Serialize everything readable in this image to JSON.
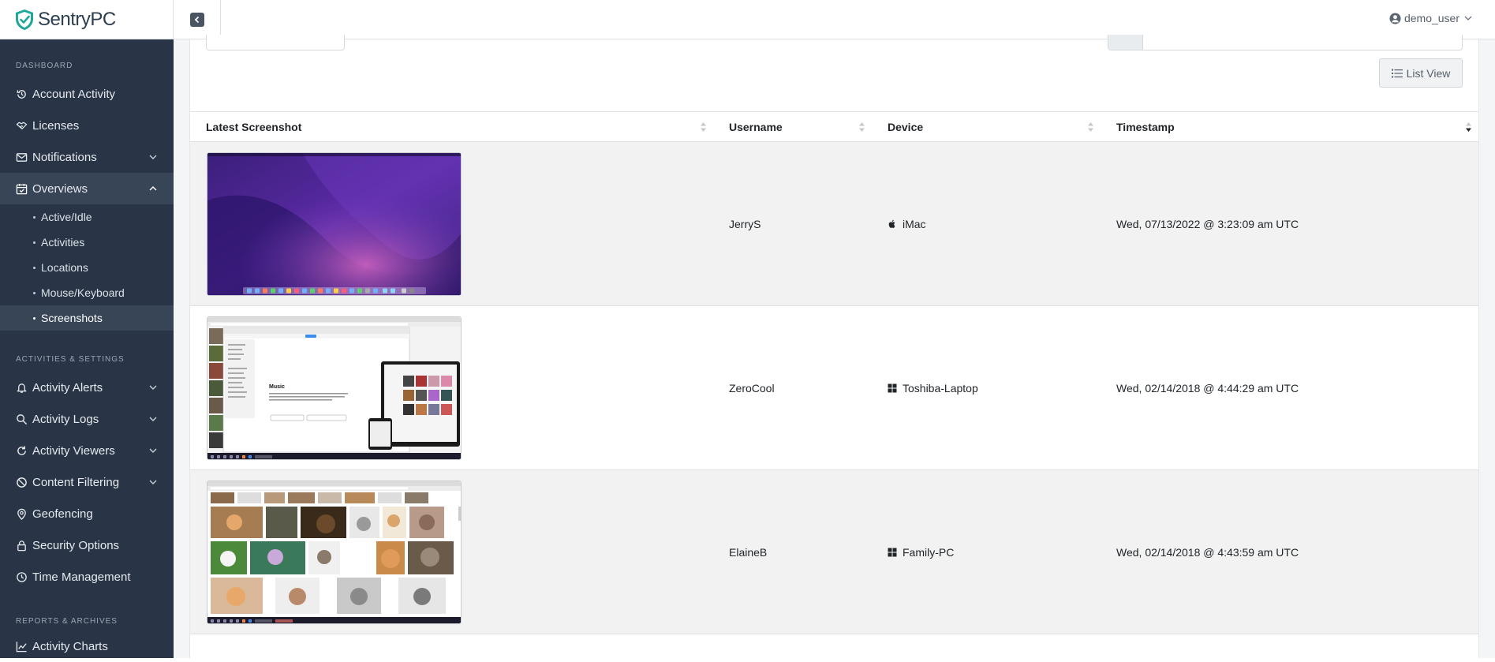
{
  "brand": {
    "name": "SentryPC"
  },
  "user": {
    "name": "demo_user"
  },
  "sidebar": {
    "sections": {
      "dashboard": "DASHBOARD",
      "activities": "ACTIVITIES & SETTINGS",
      "reports": "REPORTS & ARCHIVES"
    },
    "items": {
      "account_activity": "Account Activity",
      "licenses": "Licenses",
      "notifications": "Notifications",
      "overviews": "Overviews",
      "activity_alerts": "Activity Alerts",
      "activity_logs": "Activity Logs",
      "activity_viewers": "Activity Viewers",
      "content_filtering": "Content Filtering",
      "geofencing": "Geofencing",
      "security_options": "Security Options",
      "time_management": "Time Management",
      "activity_charts": "Activity Charts"
    },
    "subitems": {
      "active_idle": "Active/Idle",
      "activities": "Activities",
      "locations": "Locations",
      "mouse_keyboard": "Mouse/Keyboard",
      "screenshots": "Screenshots"
    }
  },
  "toolbar": {
    "list_view": "List View"
  },
  "table": {
    "headers": {
      "screenshot": "Latest Screenshot",
      "username": "Username",
      "device": "Device",
      "timestamp": "Timestamp"
    },
    "rows": [
      {
        "username": "JerryS",
        "device": "iMac",
        "device_icon": "apple-icon",
        "timestamp": "Wed, 07/13/2022 @ 3:23:09 am UTC",
        "thumb": "macos-desktop"
      },
      {
        "username": "ZeroCool",
        "device": "Toshiba-Laptop",
        "device_icon": "windows-icon",
        "timestamp": "Wed, 02/14/2018 @ 4:44:29 am UTC",
        "thumb": "music-webpage"
      },
      {
        "username": "ElaineB",
        "device": "Family-PC",
        "device_icon": "windows-icon",
        "timestamp": "Wed, 02/14/2018 @ 4:43:59 am UTC",
        "thumb": "cat-image-search"
      }
    ]
  },
  "colors": {
    "sidebar_bg": "#293546",
    "sidebar_active": "#384557",
    "brand_accent": "#1fa89a"
  }
}
